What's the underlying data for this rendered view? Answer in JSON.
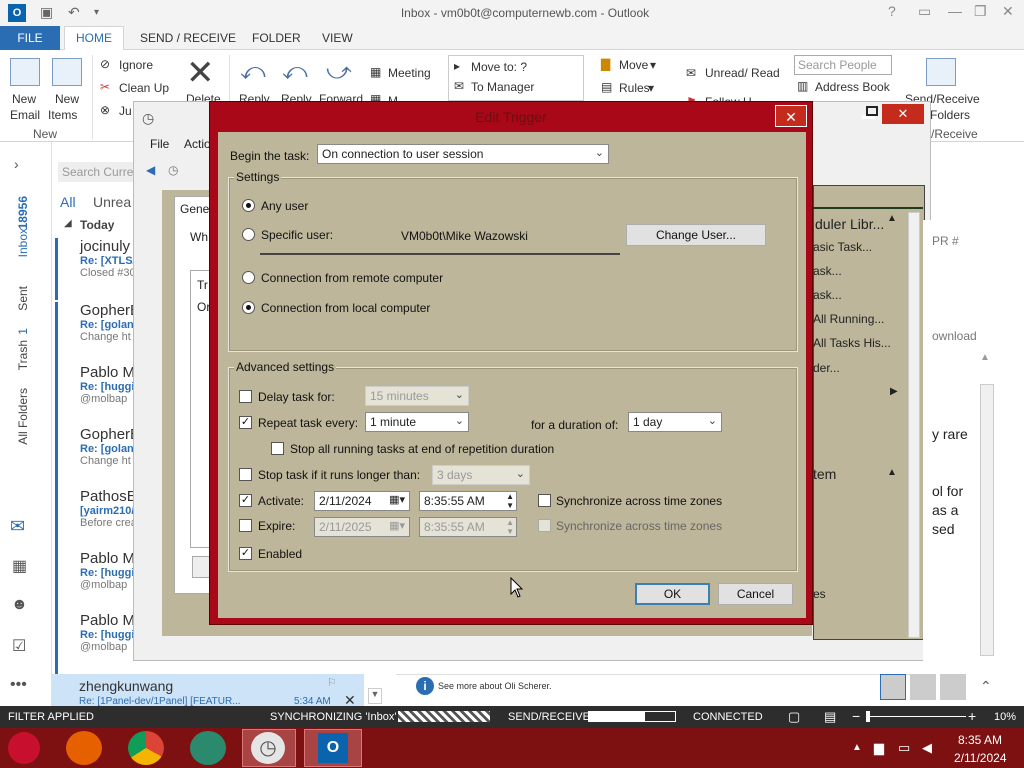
{
  "window": {
    "title": "Inbox - vm0b0t@computernewb.com - Outlook"
  },
  "ribbon_tabs": [
    "FILE",
    "HOME",
    "SEND / RECEIVE",
    "FOLDER",
    "VIEW"
  ],
  "ribbon": {
    "new_email": [
      "New",
      "Email"
    ],
    "new_items": [
      "New",
      "Items"
    ],
    "group_new": "New",
    "ignore": "Ignore",
    "clean_up": "Clean Up",
    "junk": "Ju",
    "delete": "Delete",
    "reply": "Reply",
    "reply_all": "Reply",
    "forward": "Forward",
    "meeting": "Meeting",
    "more": "M",
    "move_to": "Move to: ?",
    "to_manager": "To Manager",
    "move": "Move",
    "rules": "Rules",
    "unread_read": "Unread/ Read",
    "follow_up": "Follow U",
    "search_people": "Search People",
    "address_book": "Address Book",
    "send_receive": [
      "Send/Receive",
      "Folders"
    ],
    "send_receive_group": "/Receive"
  },
  "nav": {
    "inbox": "Inbox",
    "inbox_count": "18956",
    "sent": "Sent",
    "trash": "Trash",
    "trash_count": "1",
    "all_folders": "All Folders"
  },
  "messages": {
    "search_placeholder": "Search Curren",
    "filters": [
      "All",
      "Unrea"
    ],
    "today": "Today",
    "items": [
      {
        "sender": "jocinuly",
        "subject": "Re: [XTLS/",
        "preview": "Closed #30"
      },
      {
        "sender": "GopherB",
        "subject": "Re: [golan",
        "preview": "Change ht"
      },
      {
        "sender": "Pablo M",
        "subject": "Re: [huggi",
        "preview": "@molbap"
      },
      {
        "sender": "GopherB",
        "subject": "Re: [golan",
        "preview": "Change ht"
      },
      {
        "sender": "PathosEt",
        "subject": "[yairm210/",
        "preview": "Before crea"
      },
      {
        "sender": "Pablo M",
        "subject": "Re: [huggi",
        "preview": "@molbap"
      },
      {
        "sender": "Pablo M",
        "subject": "Re: [huggi",
        "preview": "@molbap"
      }
    ],
    "last": {
      "sender": "zhengkunwang",
      "subject": "Re: [1Panel-dev/1Panel] [FEATUR...",
      "time": "5:34 AM"
    }
  },
  "background": {
    "file": "File",
    "action": "Actio",
    "general": "Gene",
    "wh": "Wh",
    "tr": "Tr",
    "or": "Or",
    "sched_title": "duler Libr...",
    "sched_items": [
      "asic Task...",
      "ask...",
      "ask...",
      "All Running...",
      "All Tasks His...",
      "der..."
    ],
    "system": "tem",
    "es": "es",
    "right_texts": [
      "PR #",
      "ownload",
      "y rare",
      "ol for",
      "as a",
      "sed"
    ],
    "people_pane": "See more about Oli Scherer."
  },
  "dialog": {
    "title": "Edit Trigger",
    "begin_label": "Begin the task:",
    "begin_value": "On connection to user session",
    "settings_legend": "Settings",
    "any_user": "Any user",
    "specific_user": "Specific user:",
    "user_name": "VM0b0t\\Mike Wazowski",
    "change_user": "Change User...",
    "remote": "Connection from remote computer",
    "local": "Connection from local computer",
    "advanced_legend": "Advanced settings",
    "delay_label": "Delay task for:",
    "delay_value": "15 minutes",
    "repeat_label": "Repeat task every:",
    "repeat_value": "1 minute",
    "duration_label": "for a duration of:",
    "duration_value": "1 day",
    "stop_all": "Stop all running tasks at end of repetition duration",
    "stop_longer": "Stop task if it runs longer than:",
    "stop_value": "3 days",
    "activate_label": "Activate:",
    "activate_date": "2/11/2024",
    "activate_time": "8:35:55 AM",
    "sync1": "Synchronize across time zones",
    "expire_label": "Expire:",
    "expire_date": "2/11/2025",
    "expire_time": "8:35:55 AM",
    "sync2": "Synchronize across time zones",
    "enabled": "Enabled",
    "ok": "OK",
    "cancel": "Cancel"
  },
  "statusbar": {
    "filter": "FILTER APPLIED",
    "sync": "SYNCHRONIZING 'Inbox'",
    "send_receive": "SEND/RECEIVE",
    "connected": "CONNECTED",
    "zoom": "10%"
  },
  "taskbar": {
    "time": "8:35 AM",
    "date": "2/11/2024"
  }
}
